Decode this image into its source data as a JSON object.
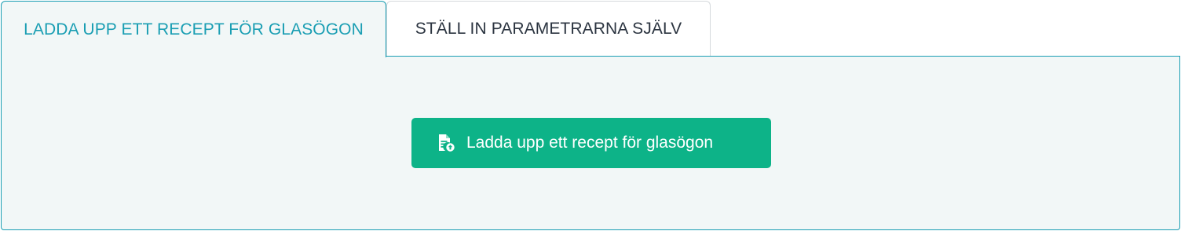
{
  "tabs": [
    {
      "label": "LADDA UPP ETT RECEPT FÖR GLASÖGON",
      "active": true
    },
    {
      "label": "STÄLL IN PARAMETRARNA SJÄLV",
      "active": false
    }
  ],
  "panel": {
    "upload_button": {
      "label": "Ladda upp ett recept för glasögon",
      "icon": "file-upload-icon"
    }
  },
  "colors": {
    "accent": "#1a9eb3",
    "button": "#0db388",
    "panel_bg": "#f2f7f7",
    "inactive_text": "#2b3440"
  }
}
